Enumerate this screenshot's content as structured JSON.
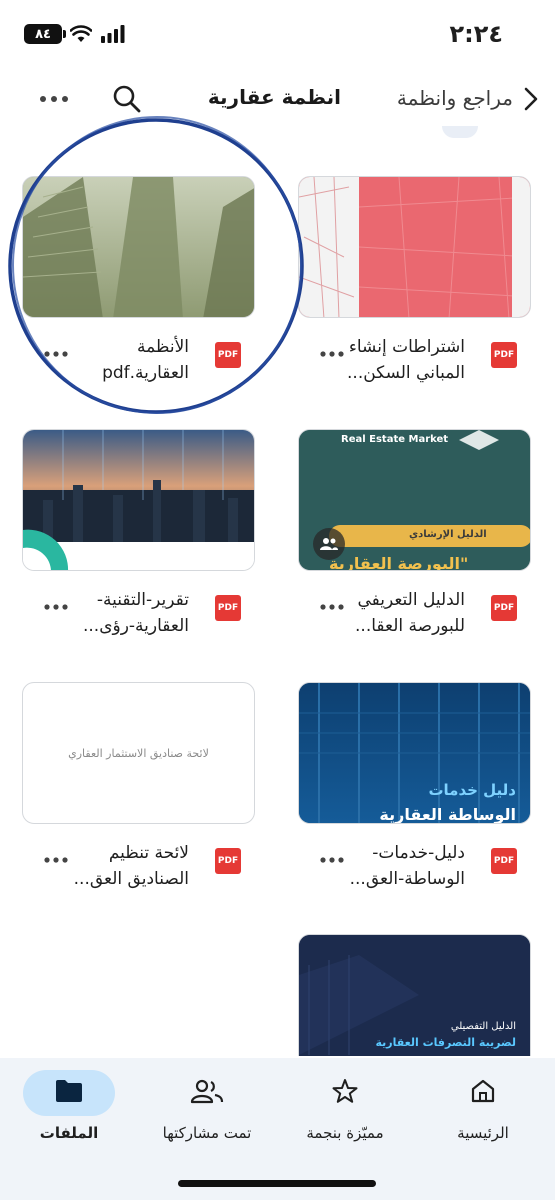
{
  "status_bar": {
    "time": "٢:٢٤",
    "battery": "٨٤"
  },
  "header": {
    "breadcrumb_parent": "مراجع وانظمة",
    "title": "انظمة عقارية"
  },
  "files": [
    {
      "name": "اشتراطات إنشاء المباني السكن...",
      "type": "PDF",
      "thumb": "map-red"
    },
    {
      "name": "الأنظمة العقارية.pdf",
      "type": "PDF",
      "thumb": "buildings-green"
    },
    {
      "name": "الدليل التعريفي للبورصة العقا...",
      "type": "PDF",
      "thumb": "real-estate-market",
      "shared": true,
      "thumb_texts": {
        "brand": "Real Estate Market",
        "tag": "الدليل الإرشادي",
        "headline": "البورصة العقارية\""
      }
    },
    {
      "name": "تقرير-التقنية-العقارية-رؤى...",
      "type": "PDF",
      "thumb": "city-night"
    },
    {
      "name": "دليل-خدمات-الوساطة-العق...",
      "type": "PDF",
      "thumb": "brokerage-blue",
      "thumb_texts": {
        "line1": "دليل خدمات",
        "line2": "الوساطة العقارية"
      }
    },
    {
      "name": "لائحة تنظيم الصناديق العق...",
      "type": "PDF",
      "thumb": "blank-doc",
      "thumb_texts": {
        "line1": "لائحة صناديق الاستثمار العقاري"
      }
    },
    {
      "name": "",
      "type": "PDF",
      "thumb": "tax-dark",
      "thumb_texts": {
        "line1": "الدليل التفصيلي",
        "line2": "لضريبة التصرفات العقارية"
      }
    }
  ],
  "bottom_nav": [
    {
      "label": "الرئيسية",
      "icon": "home-icon"
    },
    {
      "label": "مميّزة بنجمة",
      "icon": "star-icon"
    },
    {
      "label": "تمت مشاركتها",
      "icon": "people-icon"
    },
    {
      "label": "الملفات",
      "icon": "folder-icon",
      "active": true
    }
  ],
  "colors": {
    "accent_nav": "#c7e4fb",
    "pdf_red": "#e53935",
    "annotation": "#1f3f8f"
  }
}
